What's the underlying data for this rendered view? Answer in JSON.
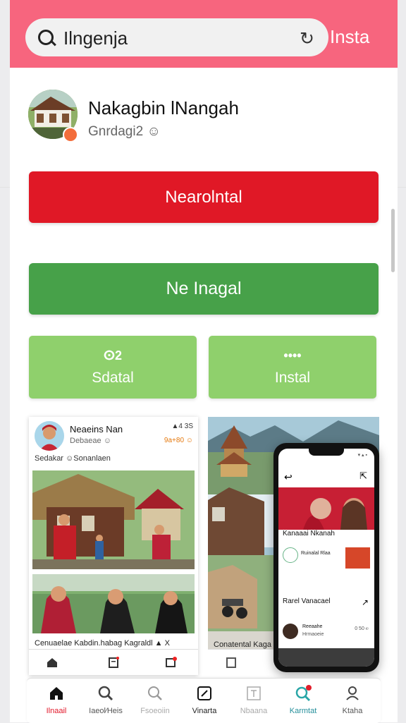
{
  "header": {
    "search_value": "Ilngenja",
    "action_label": "Insta"
  },
  "profile": {
    "name": "Nakagbin lNangah",
    "handle": "Gnrdagi2 ☺"
  },
  "buttons": {
    "primary": "Nearolntal",
    "secondary": "Ne Inagal",
    "left_icon": "ⵙ2",
    "left_label": "Sdatal",
    "right_icon": "••••",
    "right_label": "Instal"
  },
  "card": {
    "name": "Neaeins Nan",
    "sub": "Debaeae ☺",
    "meta": "▲4 3S",
    "meta2": "9a+80 ☺",
    "caption": "Sedakar ☺Sonanlaen",
    "footer": "Cenuaelae Kabdin.habag Kagraldl ▲ X"
  },
  "right_panel": {
    "footer": "Conatental Kaga Re"
  },
  "phone": {
    "status": "▾ ▴ ▪",
    "title": "Kanaaai Nkanah",
    "row_text": "Ruinalal Rlaa",
    "label": "Rarel Vanacael",
    "person_name": "Reeaahe",
    "person_sub": "Hrmaoeie",
    "person_meta": "0 50 ℮"
  },
  "nav": {
    "items": [
      {
        "label": "Ilnaail",
        "icon": "home-icon"
      },
      {
        "label": "Iaeol⁄Heis",
        "icon": "search-icon"
      },
      {
        "label": "Fsoeoiin",
        "icon": "search-outline-icon"
      },
      {
        "label": "Vinarta",
        "icon": "compose-icon"
      },
      {
        "label": "Nbaana",
        "icon": "text-icon"
      },
      {
        "label": "Karmtat",
        "icon": "search-notification-icon"
      },
      {
        "label": "Ktaha",
        "icon": "user-icon"
      }
    ]
  },
  "colors": {
    "header": "#f7657e",
    "red": "#e01826",
    "green": "#47a149",
    "light_green": "#8fd06c"
  }
}
